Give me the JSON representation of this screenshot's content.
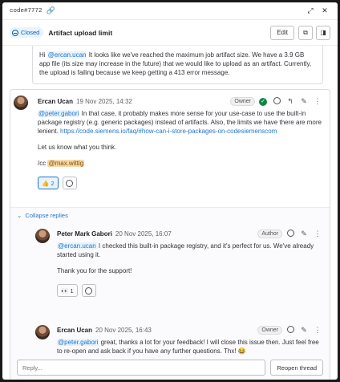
{
  "topbar": {
    "ref": "code#7772",
    "link_icon": "link-icon",
    "expand_icon": "expand-icon",
    "close_icon": "close-icon"
  },
  "header": {
    "status": "Closed",
    "title": "Artifact upload limit",
    "edit_label": "Edit",
    "icons": [
      "external-link-icon",
      "sidebar-toggle-icon"
    ]
  },
  "first_comment": {
    "before": "Hi ",
    "mention": "@ercan.ucan",
    "after": " It looks like we've reached the maximum job artifact size. We have a 3.9 GB app file (its size may increase in the future) that we would like to upload as an artifact. Currently, the upload is failing because we keep getting a 413 error message."
  },
  "main_note": {
    "author": "Ercan Ucan",
    "date": "19 Nov 2025, 14:32",
    "role": "Owner",
    "mention": "@peter.gabori",
    "text1": " In that case, it probably makes more sense for your use-case to use the built-in package registry (e.g. generic packages) instead of artifacts. Also, the limits we have there are more lenient. ",
    "url": "https://code.siemens.io/faq/#how-can-i-store-packages-on-codesiemenscom",
    "text2": "Let us know what you think.",
    "cc_prefix": "/cc ",
    "cc_mention": "@max.wittig",
    "reaction": {
      "emoji": "👍",
      "count": "2"
    }
  },
  "collapse_label": "Collapse replies",
  "reply1": {
    "author": "Peter Mark Gabori",
    "date": "20 Nov 2025, 16:07",
    "role": "Author",
    "mention": "@ercan.ucan",
    "text1": " I checked this built-in package registry, and it's perfect for us. We've already started using it.",
    "text2": "Thank you for the support!",
    "reaction": {
      "emoji": "👀",
      "count": "1"
    }
  },
  "reply2": {
    "author": "Ercan Ucan",
    "date": "20 Nov 2025, 16:43",
    "role": "Owner",
    "mention": "@peter.gabori",
    "text1": " great, thanks a lot for your feedback! I will close this issue then. Just feel free to re-open and ask back if you have any further questions. Thx! 😂"
  },
  "reply_box": {
    "placeholder": "Reply...",
    "reopen_label": "Reopen thread"
  },
  "colors": {
    "accent": "#1f75cb",
    "success": "#108548",
    "mention_bg": "#e9f3fc"
  }
}
